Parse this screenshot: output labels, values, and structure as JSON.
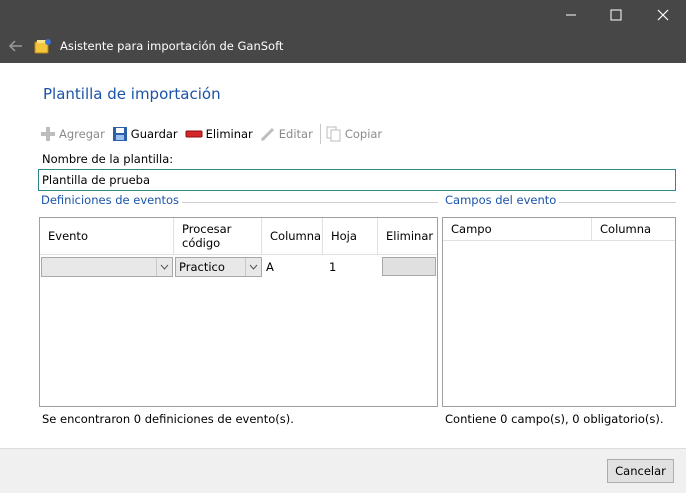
{
  "window": {
    "title": "Asistente para importación de GanSoft",
    "minimize_glyph": "—",
    "maximize_glyph": "☐",
    "close_glyph": "✕"
  },
  "heading": "Plantilla de importación",
  "toolbar": {
    "add": "Agregar",
    "save": "Guardar",
    "delete": "Eliminar",
    "edit": "Editar",
    "copy": "Copiar"
  },
  "template_name": {
    "label": "Nombre de la plantilla:",
    "value": "Plantilla de prueba"
  },
  "event_definitions": {
    "title": "Definiciones de eventos",
    "columns": [
      "Evento",
      "Procesar código",
      "Columna",
      "Hoja",
      "Eliminar"
    ],
    "rows": [
      {
        "evento": "",
        "procesar_codigo": "Practico",
        "columna": "A",
        "hoja": "1",
        "eliminar": ""
      }
    ],
    "status": "Se encontraron 0 definiciones de evento(s)."
  },
  "event_fields": {
    "title": "Campos del evento",
    "columns": [
      "Campo",
      "Columna"
    ],
    "status": "Contiene 0 campo(s), 0 obligatorio(s)."
  },
  "footer": {
    "cancel": "Cancelar"
  },
  "colors": {
    "titlebar": "#474747",
    "heading": "#1a53a8",
    "input_border": "#2d8a8c",
    "footer": "#f0f0f0"
  }
}
